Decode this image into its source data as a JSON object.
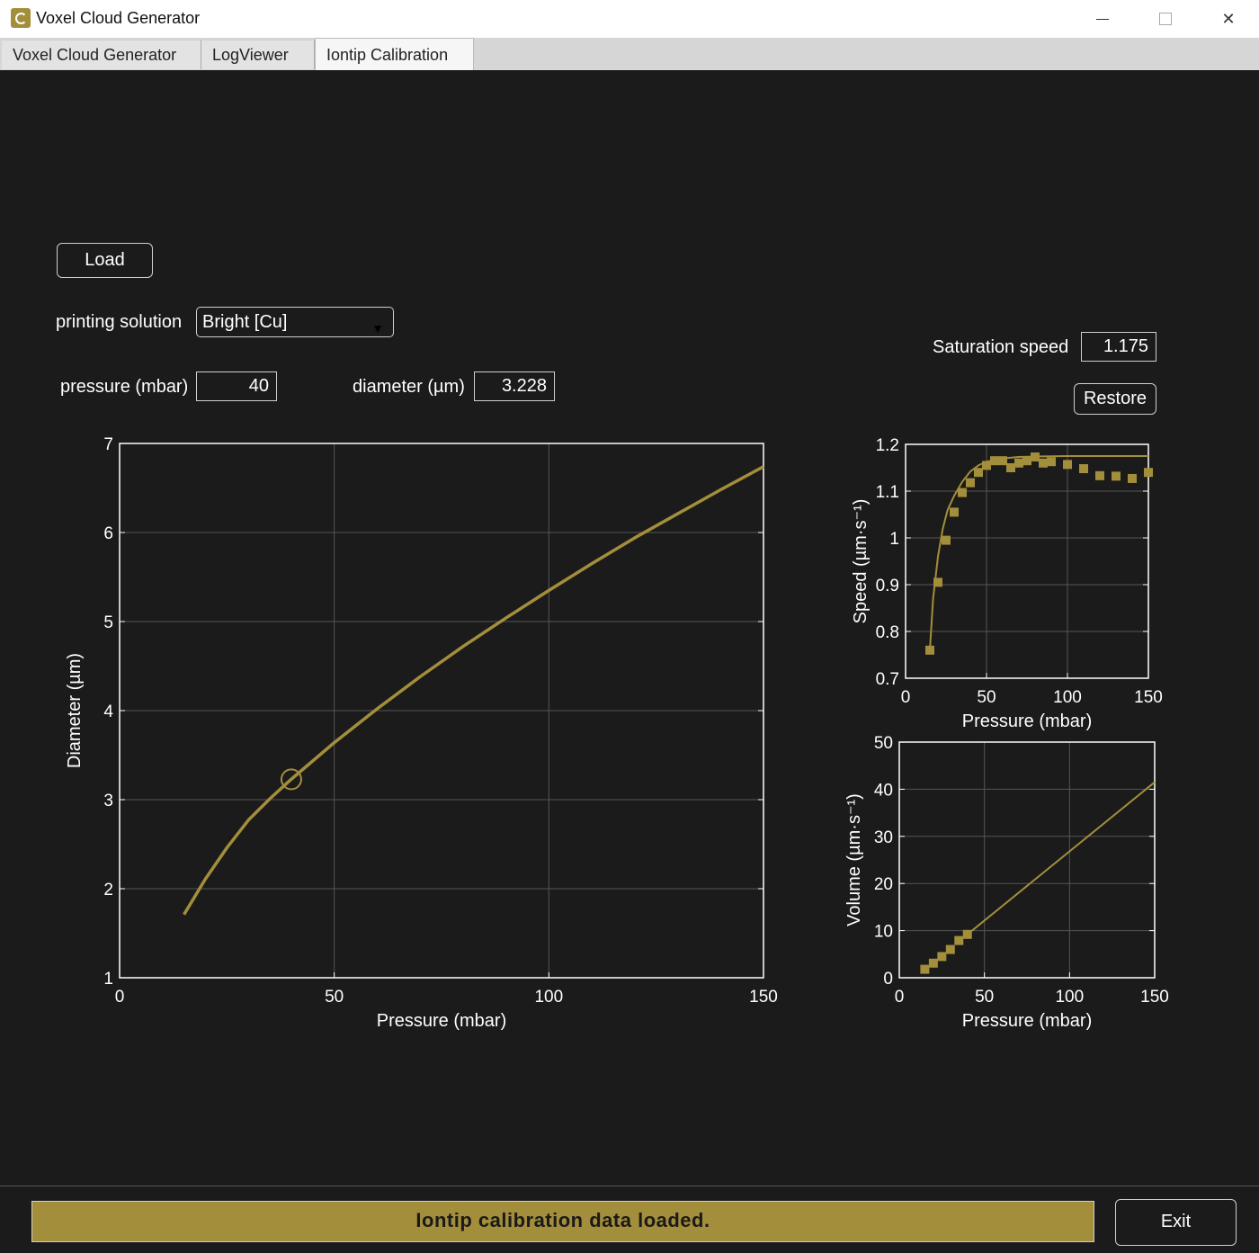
{
  "window": {
    "title": "Voxel Cloud Generator"
  },
  "tabs": [
    {
      "label": "Voxel Cloud Generator",
      "active": false
    },
    {
      "label": "LogViewer",
      "active": false
    },
    {
      "label": "Iontip Calibration",
      "active": true
    }
  ],
  "controls": {
    "load_label": "Load",
    "solution_label": "printing solution",
    "solution_value": "Bright [Cu]",
    "pressure_label": "pressure (mbar)",
    "pressure_value": "40",
    "diameter_label": "diameter (µm)",
    "diameter_value": "3.228",
    "saturation_label": "Saturation speed",
    "saturation_value": "1.175",
    "restore_label": "Restore"
  },
  "status": {
    "message": "Iontip calibration data loaded."
  },
  "exit_label": "Exit",
  "colors": {
    "accent": "#a38e3b",
    "background": "#1b1b1b",
    "axis": "#ffffff",
    "grid": "#555555"
  },
  "chart_data": [
    {
      "id": "diameter",
      "type": "line",
      "xlabel": "Pressure (mbar)",
      "ylabel": "Diameter (µm)",
      "xlim": [
        0,
        150
      ],
      "ylim": [
        1,
        7
      ],
      "xticks": [
        0,
        50,
        100,
        150
      ],
      "yticks": [
        1,
        2,
        3,
        4,
        5,
        6,
        7
      ],
      "grid": true,
      "series": [
        {
          "x": [
            15,
            20,
            25,
            30,
            35,
            40,
            50,
            60,
            70,
            80,
            90,
            100,
            110,
            120,
            130,
            140,
            150
          ],
          "y": [
            1.71,
            2.11,
            2.46,
            2.77,
            3.01,
            3.23,
            3.64,
            4.02,
            4.38,
            4.72,
            5.04,
            5.35,
            5.65,
            5.94,
            6.21,
            6.48,
            6.74
          ]
        }
      ],
      "marker": {
        "x": 40,
        "y": 3.228
      }
    },
    {
      "id": "speed",
      "type": "scatter",
      "xlabel": "Pressure (mbar)",
      "ylabel": "Speed (µm·s⁻¹)",
      "xlim": [
        0,
        150
      ],
      "ylim": [
        0.7,
        1.2
      ],
      "xticks": [
        0,
        50,
        100,
        150
      ],
      "yticks": [
        "0.7",
        "0.8",
        "0.9",
        "1",
        "1.1",
        "1.2"
      ],
      "grid": true,
      "points": {
        "x": [
          15,
          20,
          25,
          30,
          35,
          40,
          45,
          50,
          55,
          60,
          65,
          70,
          75,
          80,
          85,
          90,
          100,
          110,
          120,
          130,
          140,
          150
        ],
        "y": [
          0.76,
          0.905,
          0.995,
          1.055,
          1.097,
          1.118,
          1.14,
          1.155,
          1.165,
          1.165,
          1.15,
          1.16,
          1.165,
          1.173,
          1.16,
          1.163,
          1.157,
          1.148,
          1.133,
          1.132,
          1.127,
          1.14
        ]
      },
      "fit": {
        "x": [
          15,
          17,
          20,
          23,
          26,
          30,
          35,
          40,
          45,
          50,
          60,
          70,
          80,
          100,
          120,
          150
        ],
        "y": [
          0.76,
          0.87,
          0.96,
          1.02,
          1.06,
          1.09,
          1.12,
          1.142,
          1.155,
          1.163,
          1.17,
          1.173,
          1.174,
          1.175,
          1.175,
          1.175
        ]
      }
    },
    {
      "id": "volume",
      "type": "scatter",
      "xlabel": "Pressure (mbar)",
      "ylabel": "Volume (µm·s⁻¹)",
      "xlim": [
        0,
        150
      ],
      "ylim": [
        0,
        50
      ],
      "xticks": [
        0,
        50,
        100,
        150
      ],
      "yticks": [
        0,
        10,
        20,
        30,
        40,
        50
      ],
      "grid": true,
      "points": {
        "x": [
          15,
          20,
          25,
          30,
          35,
          40
        ],
        "y": [
          1.8,
          3.1,
          4.5,
          6.0,
          7.9,
          9.2
        ]
      },
      "fit": {
        "x": [
          40,
          150
        ],
        "y": [
          9.2,
          41.5
        ]
      }
    }
  ]
}
